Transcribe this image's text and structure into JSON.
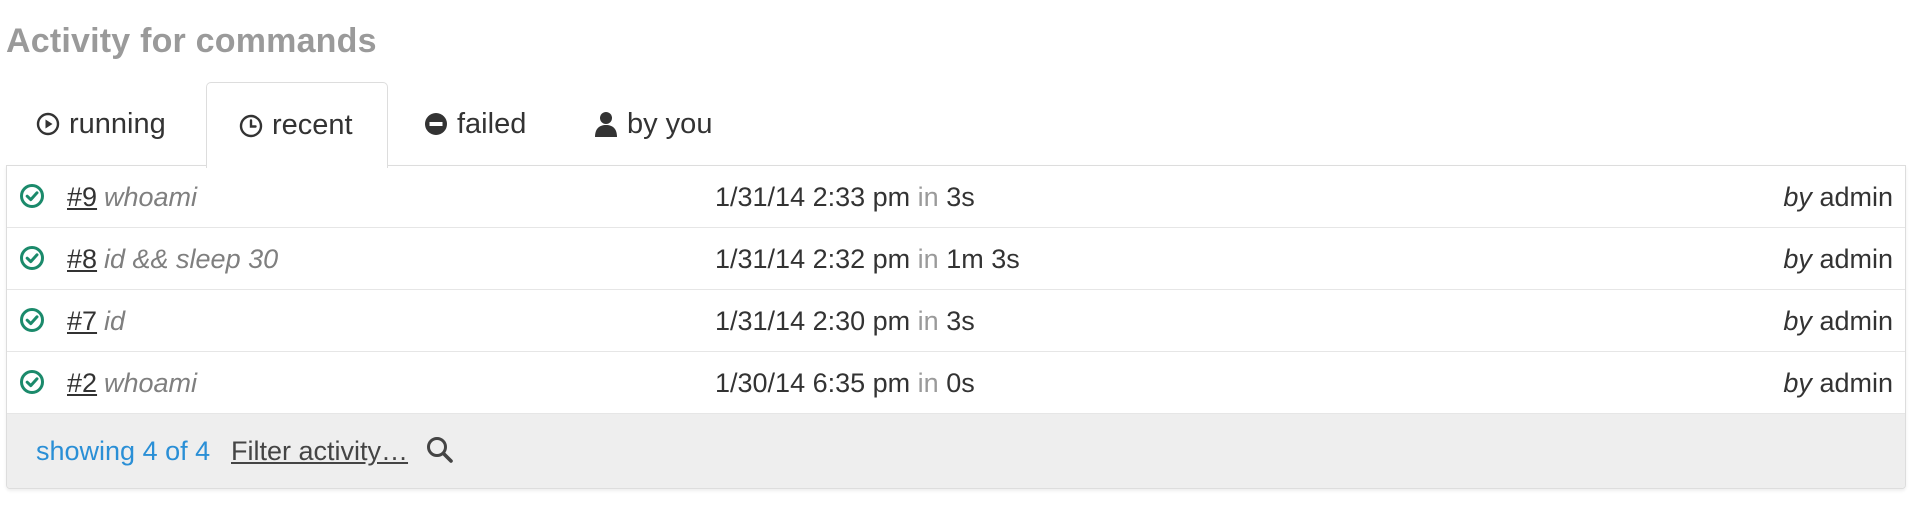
{
  "page": {
    "title": "Activity for commands"
  },
  "tabs": [
    {
      "label": "running",
      "icon": "play-circle-icon",
      "active": false
    },
    {
      "label": "recent",
      "icon": "clock-icon",
      "active": true
    },
    {
      "label": "failed",
      "icon": "minus-circle-icon",
      "active": false
    },
    {
      "label": "by you",
      "icon": "user-icon",
      "active": false
    }
  ],
  "rows": [
    {
      "status_icon": "check-circle-icon",
      "number": "#9",
      "command": "whoami",
      "datetime": "1/31/14 2:33 pm",
      "in_label": "in",
      "duration": "3s",
      "by_label": "by",
      "user": "admin"
    },
    {
      "status_icon": "check-circle-icon",
      "number": "#8",
      "command": "id && sleep 30",
      "datetime": "1/31/14 2:32 pm",
      "in_label": "in",
      "duration": "1m 3s",
      "by_label": "by",
      "user": "admin"
    },
    {
      "status_icon": "check-circle-icon",
      "number": "#7",
      "command": "id",
      "datetime": "1/31/14 2:30 pm",
      "in_label": "in",
      "duration": "3s",
      "by_label": "by",
      "user": "admin"
    },
    {
      "status_icon": "check-circle-icon",
      "number": "#2",
      "command": "whoami",
      "datetime": "1/30/14 6:35 pm",
      "in_label": "in",
      "duration": "0s",
      "by_label": "by",
      "user": "admin"
    }
  ],
  "footer": {
    "showing": "showing 4 of 4",
    "filter_label": "Filter activity…",
    "search_icon": "search-icon"
  },
  "colors": {
    "success": "#1b8a6b",
    "link_blue": "#2a8fd6",
    "muted": "#9a9a9a",
    "footer_bg": "#eeeeee"
  }
}
